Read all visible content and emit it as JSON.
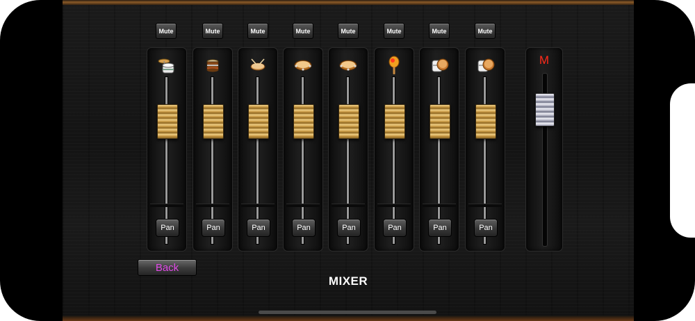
{
  "window": {
    "title": "MIXER"
  },
  "channels": [
    {
      "mute_label": "Mute",
      "pan_label": "Pan",
      "instrument_icon": "drum-kit-icon",
      "level": 0.72
    },
    {
      "mute_label": "Mute",
      "pan_label": "Pan",
      "instrument_icon": "cajon-icon",
      "level": 0.72
    },
    {
      "mute_label": "Mute",
      "pan_label": "Pan",
      "instrument_icon": "drum-sticks-icon",
      "level": 0.72
    },
    {
      "mute_label": "Mute",
      "pan_label": "Pan",
      "instrument_icon": "tambourine-icon",
      "level": 0.72
    },
    {
      "mute_label": "Mute",
      "pan_label": "Pan",
      "instrument_icon": "tambourine-icon",
      "level": 0.72
    },
    {
      "mute_label": "Mute",
      "pan_label": "Pan",
      "instrument_icon": "maraca-icon",
      "level": 0.72
    },
    {
      "mute_label": "Mute",
      "pan_label": "Pan",
      "instrument_icon": "conga-icon",
      "level": 0.72
    },
    {
      "mute_label": "Mute",
      "pan_label": "Pan",
      "instrument_icon": "conga-icon",
      "level": 0.72
    }
  ],
  "master": {
    "label": "M",
    "level": 0.85
  },
  "footer": {
    "back_label": "Back",
    "title": "MIXER"
  },
  "colors": {
    "back_text": "#e14be8",
    "master_label": "#ff2a1a",
    "fader_gold": "#d4a550",
    "fader_silver": "#b9bac8"
  }
}
